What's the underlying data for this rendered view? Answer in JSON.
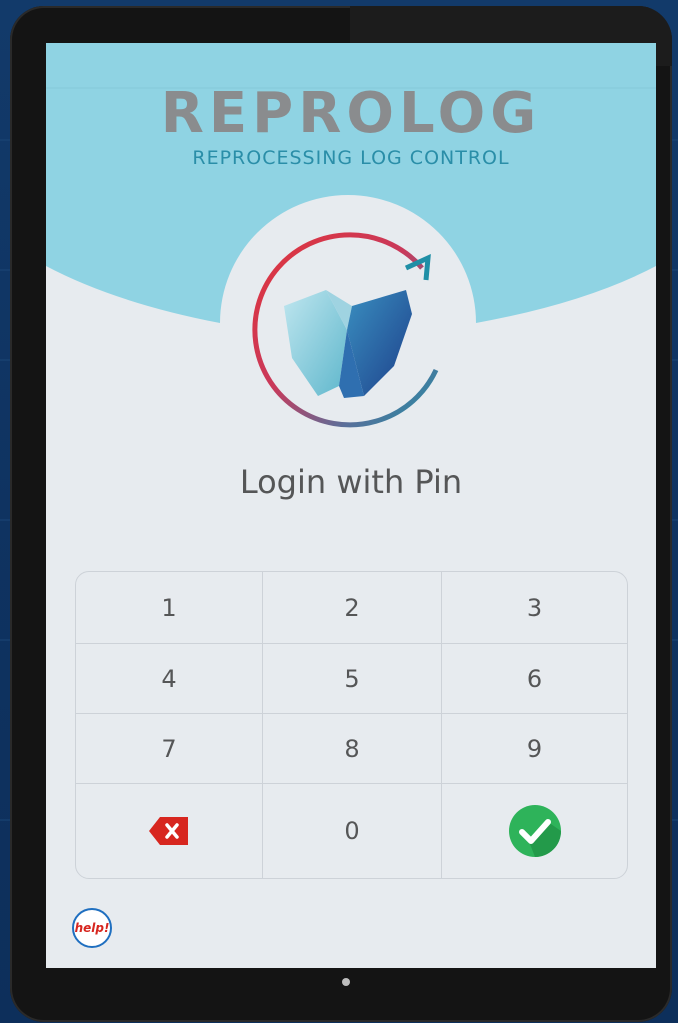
{
  "app": {
    "title": "REPROLOG",
    "subtitle": "REPROCESSING LOG CONTROL"
  },
  "login": {
    "heading": "Login with Pin"
  },
  "keypad": {
    "keys": [
      "1",
      "2",
      "3",
      "4",
      "5",
      "6",
      "7",
      "8",
      "9",
      "0"
    ],
    "backspace_icon": "backspace-icon",
    "confirm_icon": "checkmark-icon"
  },
  "help": {
    "label": "help!"
  },
  "colors": {
    "header_bg": "#8fd3e3",
    "screen_bg": "#e7ebef",
    "brand_title": "#8a8c8e",
    "brand_sub": "#2a8ea8",
    "delete_red": "#d7261f",
    "confirm_green": "#2eb35a",
    "ring_red": "#e0343c",
    "ring_teal": "#1f8fa6"
  }
}
